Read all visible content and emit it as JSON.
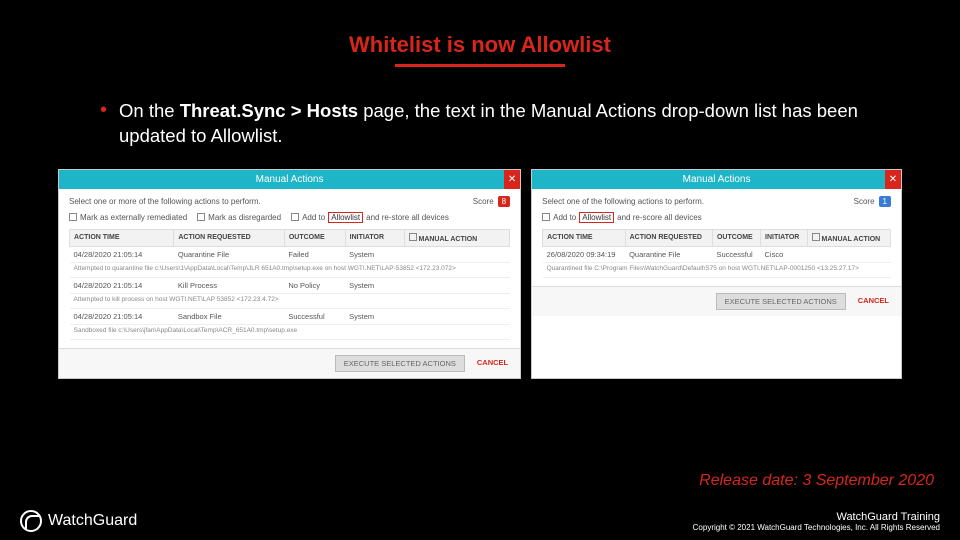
{
  "title": "Whitelist is now Allowlist",
  "bullet": {
    "prefix": "On the ",
    "bold": "Threat.Sync > Hosts",
    "suffix": " page, the text in the Manual Actions drop-down list has been updated to Allowlist."
  },
  "panelLeft": {
    "header": "Manual Actions",
    "instruction": "Select one or more of the following actions to perform.",
    "scoreLabel": "Score",
    "scoreValue": "8",
    "checks": {
      "c1": "Mark as externally remediated",
      "c2": "Mark as disregarded",
      "c3a": "Add to ",
      "c3hl": "Allowlist",
      "c3b": " and re-store all devices"
    },
    "cols": {
      "c1": "ACTION TIME",
      "c2": "ACTION REQUESTED",
      "c3": "OUTCOME",
      "c4": "INITIATOR",
      "c5": "MANUAL ACTION"
    },
    "rows": [
      {
        "t": "04/28/2020 21:05:14",
        "a": "Quarantine File",
        "o": "Failed",
        "i": "System",
        "sub": "Attempted to quarantine file c:\\Users\\1\\AppData\\Local\\Temp\\JLR 651A0.tmp\\setup.exe on host WGTI.NET\\LAP-53852 <172.23.072>"
      },
      {
        "t": "04/28/2020 21:05:14",
        "a": "Kill Process",
        "o": "No Policy",
        "i": "System",
        "sub": "Attempted to kill process on host WGTI.NET\\LAP 53852 <172.23.4.72>"
      },
      {
        "t": "04/28/2020 21:05:14",
        "a": "Sandbox File",
        "o": "Successful",
        "i": "System",
        "sub": "Sandboxed file c:\\Users\\jfan\\AppData\\Local\\Temp\\ACR_651A0.tmp\\setup.exe"
      }
    ],
    "exec": "EXECUTE SELECTED ACTIONS",
    "cancel": "CANCEL"
  },
  "panelRight": {
    "header": "Manual Actions",
    "instruction": "Select one of the following actions to perform.",
    "scoreLabel": "Score",
    "scoreValue": "1",
    "checks": {
      "c1a": "Add to ",
      "c1hl": "Allowlist",
      "c1b": " and re-score all devices"
    },
    "cols": {
      "c1": "ACTION TIME",
      "c2": "ACTION REQUESTED",
      "c3": "OUTCOME",
      "c4": "INITIATOR",
      "c5": "MANUAL ACTION"
    },
    "rows": [
      {
        "t": "26/08/2020 09:34:19",
        "a": "Quarantine File",
        "o": "Successful",
        "i": "Cisco",
        "sub": "Quarantined file C:\\Program Files\\WatchGuard\\Default\\S75 on host WGTI.NET\\LAP-0001250 <13.25.27.17>"
      }
    ],
    "exec": "EXECUTE SELECTED ACTIONS",
    "cancel": "CANCEL"
  },
  "release": "Release date: 3 September 2020",
  "footer": {
    "brand": "WatchGuard",
    "line1": "WatchGuard Training",
    "line2": "Copyright © 2021 WatchGuard Technologies, Inc. All Rights Reserved"
  }
}
